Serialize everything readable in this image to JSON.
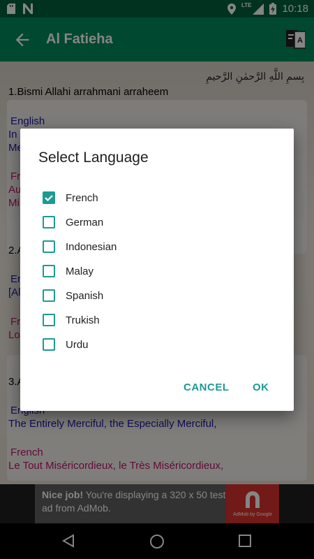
{
  "status_bar": {
    "time": "10:18",
    "network": "LTE",
    "icons": [
      "sd-card-icon",
      "n-notification-icon",
      "location-icon",
      "signal-icon",
      "battery-icon"
    ]
  },
  "app_bar": {
    "title": "Al Fatieha"
  },
  "content": {
    "basmala_arabic": "بِسمِ اللَّهِ الرَّحمٰنِ الرَّحيمِ",
    "verse1": "1.Bismi Allahi arrahmani arraheem",
    "verse1_en_label": "English",
    "verse1_en_text_start": "In",
    "verse1_en_text_cont": "Me",
    "verse1_fr_label": "Fr",
    "verse1_fr_text_start": "Au",
    "verse1_fr_text_cont": "Mi",
    "verse2_partial": "2.A",
    "verse2_en_label": "En",
    "verse2_en_text": "[Al",
    "verse2_fr_label": "Fr",
    "verse2_fr_text": "Lo",
    "verse3_partial": "3.A",
    "verse3_en_label": "English",
    "verse3_en_text": "The Entirely Merciful, the Especially Merciful,",
    "verse3_fr_label": "French",
    "verse3_fr_text": "Le Tout Miséricordieux, le Très Miséricordieux,"
  },
  "dialog": {
    "title": "Select Language",
    "options": [
      {
        "label": "French",
        "checked": true
      },
      {
        "label": "German",
        "checked": false
      },
      {
        "label": "Indonesian",
        "checked": false
      },
      {
        "label": "Malay",
        "checked": false
      },
      {
        "label": "Spanish",
        "checked": false
      },
      {
        "label": "Trukish",
        "checked": false
      },
      {
        "label": "Urdu",
        "checked": false
      }
    ],
    "cancel_label": "CANCEL",
    "ok_label": "OK"
  },
  "ad": {
    "headline": "Nice job!",
    "body": "You're displaying a 320 x 50 test ad from AdMob.",
    "brand": "AdMob by Google"
  },
  "colors": {
    "app_bar": "#008a5a",
    "status_bar": "#00603e",
    "accent": "#1d9a93",
    "en_label": "#1a1ab0",
    "fr_label": "#c0146e"
  }
}
